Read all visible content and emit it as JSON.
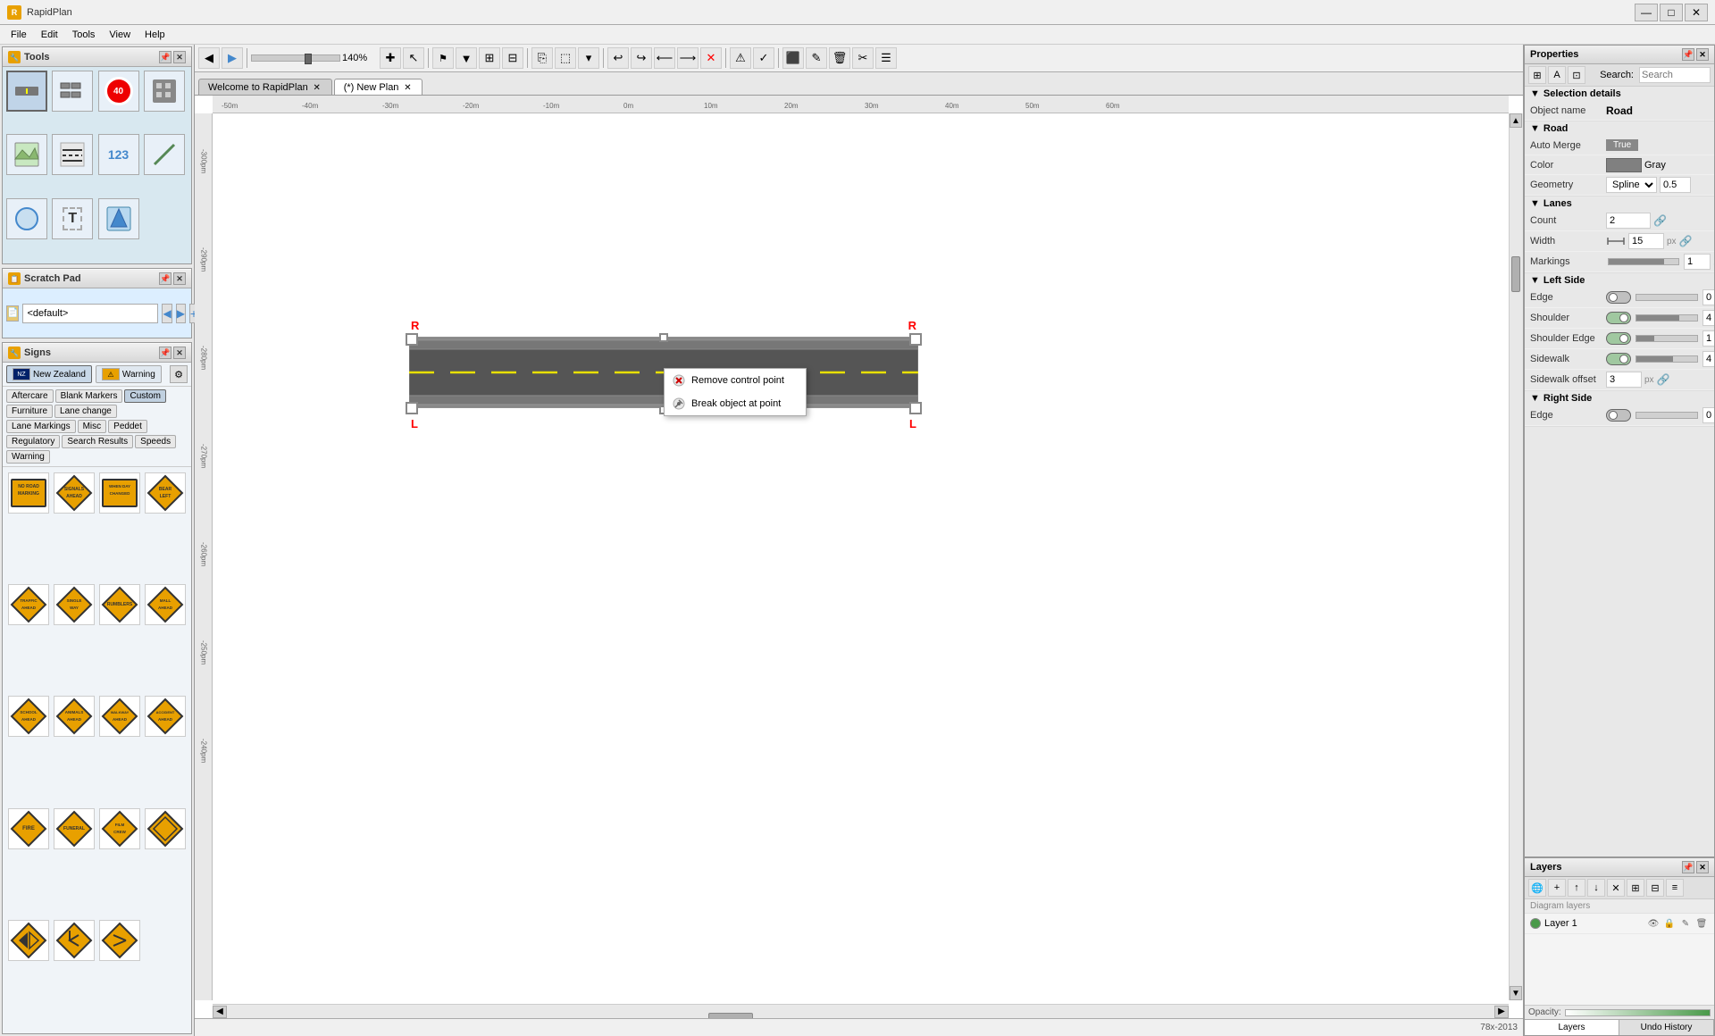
{
  "app": {
    "title": "RapidPlan",
    "window_controls": [
      "—",
      "□",
      "✕"
    ]
  },
  "menu": {
    "items": [
      "File",
      "Edit",
      "Tools",
      "View",
      "Help"
    ]
  },
  "toolbar": {
    "zoom_value": "140%",
    "zoom_label": "140%"
  },
  "tabs": [
    {
      "label": "Welcome to RapidPlan",
      "active": false,
      "closable": true
    },
    {
      "label": "(*) New Plan",
      "active": true,
      "closable": true
    }
  ],
  "tools_panel": {
    "title": "Tools",
    "tools": [
      {
        "name": "road-tool",
        "icon": "🛣",
        "label": "Road"
      },
      {
        "name": "barrier-tool",
        "icon": "▤",
        "label": "Barrier"
      },
      {
        "name": "speed-sign-tool",
        "icon": "40",
        "label": "Speed"
      },
      {
        "name": "texture-tool",
        "icon": "▦",
        "label": "Texture"
      },
      {
        "name": "terrain-tool",
        "icon": "⛰",
        "label": "Terrain"
      },
      {
        "name": "marking-tool",
        "icon": "≡",
        "label": "Marking"
      },
      {
        "name": "number-tool",
        "icon": "123",
        "label": "Number"
      },
      {
        "name": "line-tool",
        "icon": "/",
        "label": "Line"
      },
      {
        "name": "circle-tool",
        "icon": "○",
        "label": "Circle"
      },
      {
        "name": "text-tool",
        "icon": "T",
        "label": "Text"
      },
      {
        "name": "symbol-tool",
        "icon": "◈",
        "label": "Symbol"
      }
    ]
  },
  "scratch_pad": {
    "title": "Scratch Pad",
    "default_value": "<default>",
    "placeholder": "<default>"
  },
  "signs_panel": {
    "title": "Signs",
    "countries": [
      {
        "name": "New Zealand",
        "active": true
      },
      {
        "name": "Warning",
        "active": false
      }
    ],
    "tags": [
      "Aftercare",
      "Blank Markers",
      "Custom",
      "Furniture",
      "Lane change",
      "Lane Markings",
      "Misc",
      "Peddet",
      "Regulatory",
      "Search Results",
      "Speeds",
      "Warning"
    ],
    "signs": [
      {
        "id": 1,
        "label": "NO ROAD MARKING",
        "type": "rect"
      },
      {
        "id": 2,
        "label": "SIGNALS AHEAD",
        "type": "diamond"
      },
      {
        "id": 3,
        "label": "WHEN DAY CHANGED",
        "type": "rect"
      },
      {
        "id": 4,
        "label": "BEAR LEFT",
        "type": "diamond"
      },
      {
        "id": 5,
        "label": "TRAFFIC AHEAD",
        "type": "diamond"
      },
      {
        "id": 6,
        "label": "SINGLE WAY",
        "type": "diamond"
      },
      {
        "id": 7,
        "label": "RUMBLERS",
        "type": "diamond"
      },
      {
        "id": 8,
        "label": "MALL AHEAD",
        "type": "diamond"
      },
      {
        "id": 9,
        "label": "SCHOOL AHEAD",
        "type": "diamond"
      },
      {
        "id": 10,
        "label": "ANIMALS AHEAD",
        "type": "diamond"
      },
      {
        "id": 11,
        "label": "WALKWAY AHEAD",
        "type": "diamond"
      },
      {
        "id": 12,
        "label": "ACCIDENT AHEAD",
        "type": "diamond"
      },
      {
        "id": 13,
        "label": "FIRE",
        "type": "diamond"
      },
      {
        "id": 14,
        "label": "FUNERAL",
        "type": "diamond"
      },
      {
        "id": 15,
        "label": "FILM CREW",
        "type": "diamond"
      },
      {
        "id": 16,
        "label": "HAZARD DIAMOND",
        "type": "diamond"
      },
      {
        "id": 17,
        "label": "MERGE",
        "type": "diamond"
      },
      {
        "id": 18,
        "label": "KEEP LEFT",
        "type": "diamond"
      },
      {
        "id": 19,
        "label": "DETOUR",
        "type": "diamond"
      }
    ]
  },
  "properties_panel": {
    "title": "Properties",
    "search_placeholder": "Search:",
    "sections": {
      "selection_details": {
        "title": "Selection details",
        "object_name_label": "Object name",
        "object_name_value": "Road"
      },
      "road": {
        "title": "Road",
        "auto_merge_label": "Auto Merge",
        "auto_merge_value": "True",
        "color_label": "Color",
        "color_value": "Gray",
        "geometry_label": "Geometry",
        "geometry_value": "Spline",
        "geometry_num": "0.5"
      },
      "lanes": {
        "title": "Lanes",
        "count_label": "Count",
        "count_value": "2",
        "width_label": "Width",
        "width_value": "15",
        "width_unit": "px",
        "markings_label": "Markings",
        "markings_value": "1"
      },
      "left_side": {
        "title": "Left Side",
        "edge_label": "Edge",
        "edge_value": "0",
        "shoulder_label": "Shoulder",
        "shoulder_value": "4",
        "shoulder_edge_label": "Shoulder Edge",
        "shoulder_edge_value": "1",
        "sidewalk_label": "Sidewalk",
        "sidewalk_value": "4",
        "sidewalk_offset_label": "Sidewalk offset",
        "sidewalk_offset_value": "3",
        "sidewalk_offset_unit": "px"
      },
      "right_side": {
        "title": "Right Side",
        "edge_label": "Edge",
        "edge_value": "0"
      }
    }
  },
  "layers_panel": {
    "title": "Layers",
    "diagram_layers_label": "Diagram layers",
    "layers": [
      {
        "name": "Layer 1",
        "color": "#4a9a4a",
        "visible": true,
        "locked": false
      }
    ],
    "opacity_label": "Opacity:",
    "tabs": [
      "Layers",
      "Undo History"
    ]
  },
  "context_menu": {
    "items": [
      {
        "id": "remove-control-point",
        "label": "Remove control point",
        "icon": "✕"
      },
      {
        "id": "break-object-at-point",
        "label": "Break object at point",
        "icon": "✂"
      }
    ]
  },
  "status_bar": {
    "coords": "78x-2013"
  },
  "road": {
    "labels": [
      "R",
      "L",
      "R",
      "L"
    ]
  }
}
